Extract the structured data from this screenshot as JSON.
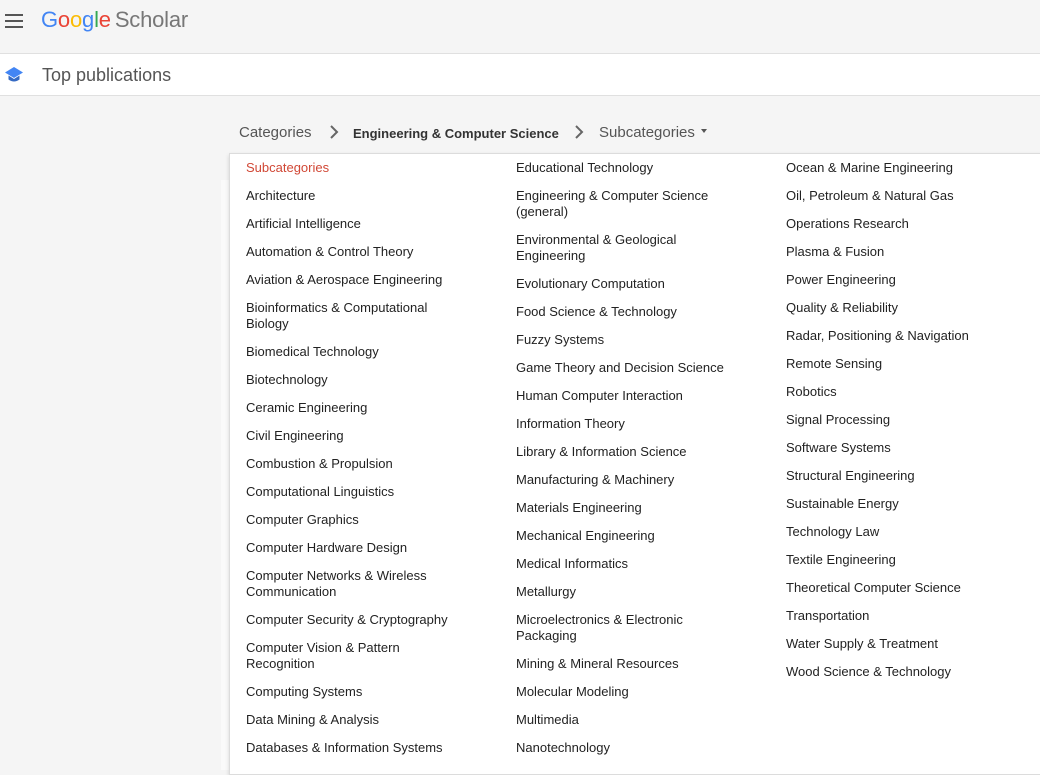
{
  "header": {
    "logo_letters": [
      "G",
      "o",
      "o",
      "g",
      "l",
      "e"
    ],
    "logo_product": "Scholar",
    "menu_icon": "hamburger-menu-icon"
  },
  "subheader": {
    "icon": "graduation-cap-icon",
    "title": "Top publications"
  },
  "breadcrumb": {
    "categories_label": "Categories",
    "current_label": "Engineering & Computer Science",
    "subcategories_label": "Subcategories"
  },
  "colors": {
    "active_item": "#d14836",
    "text": "#222222"
  },
  "dropdown": {
    "columns": [
      [
        "Subcategories",
        "Architecture",
        "Artificial Intelligence",
        "Automation & Control Theory",
        "Aviation & Aerospace Engineering",
        "Bioinformatics & Computational Biology",
        "Biomedical Technology",
        "Biotechnology",
        "Ceramic Engineering",
        "Civil Engineering",
        "Combustion & Propulsion",
        "Computational Linguistics",
        "Computer Graphics",
        "Computer Hardware Design",
        "Computer Networks & Wireless Communication",
        "Computer Security & Cryptography",
        "Computer Vision & Pattern Recognition",
        "Computing Systems",
        "Data Mining & Analysis",
        "Databases & Information Systems"
      ],
      [
        "Educational Technology",
        "Engineering & Computer Science (general)",
        "Environmental & Geological Engineering",
        "Evolutionary Computation",
        "Food Science & Technology",
        "Fuzzy Systems",
        "Game Theory and Decision Science",
        "Human Computer Interaction",
        "Information Theory",
        "Library & Information Science",
        "Manufacturing & Machinery",
        "Materials Engineering",
        "Mechanical Engineering",
        "Medical Informatics",
        "Metallurgy",
        "Microelectronics & Electronic Packaging",
        "Mining & Mineral Resources",
        "Molecular Modeling",
        "Multimedia",
        "Nanotechnology"
      ],
      [
        "Ocean & Marine Engineering",
        "Oil, Petroleum & Natural Gas",
        "Operations Research",
        "Plasma & Fusion",
        "Power Engineering",
        "Quality & Reliability",
        "Radar, Positioning & Navigation",
        "Remote Sensing",
        "Robotics",
        "Signal Processing",
        "Software Systems",
        "Structural Engineering",
        "Sustainable Energy",
        "Technology Law",
        "Textile Engineering",
        "Theoretical Computer Science",
        "Transportation",
        "Water Supply & Treatment",
        "Wood Science & Technology"
      ]
    ]
  }
}
